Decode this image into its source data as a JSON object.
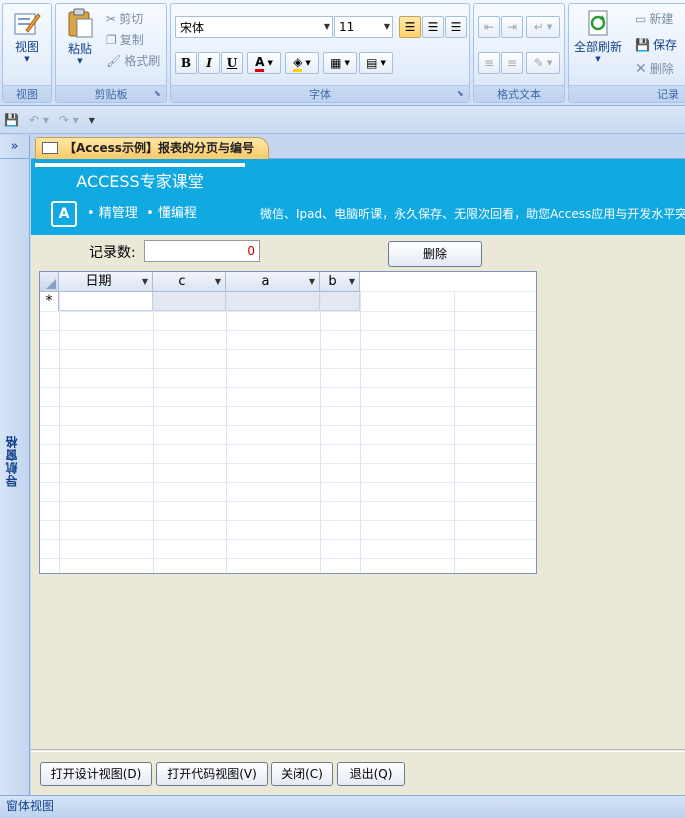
{
  "ribbon": {
    "groups": {
      "views": {
        "label": "视图",
        "button": "视图"
      },
      "clipboard": {
        "label": "剪贴板",
        "paste": "粘贴",
        "cut": "剪切",
        "copy": "复制",
        "format_painter": "格式刷"
      },
      "font": {
        "label": "字体",
        "font_name": "宋体",
        "font_size": "11",
        "bold": "B",
        "italic": "I",
        "underline": "U",
        "font_color_glyph": "A"
      },
      "rich_text": {
        "label": "格式文本"
      },
      "records": {
        "label": "记录",
        "refresh_all": "全部刷新",
        "new": "新建",
        "save": "保存",
        "delete": "删除"
      }
    }
  },
  "nav_pane": {
    "toggle": "»",
    "label": "导航窗格"
  },
  "document_tab": {
    "title": "【Access示例】报表的分页与编号"
  },
  "banner": {
    "title": "ACCESS专家课堂",
    "subtitle": "• 精管理  • 懂编程",
    "logo_letter": "A",
    "slogan": "微信、Ipad、电脑听课，永久保存、无限次回看，助您Access应用与开发水平突"
  },
  "form": {
    "record_count_label": "记录数:",
    "record_count_value": "0",
    "delete_button": "删除"
  },
  "datasheet": {
    "columns": [
      "日期",
      "c",
      "a",
      "b"
    ],
    "new_row_marker": "*"
  },
  "footer": {
    "buttons": [
      "打开设计视图(D)",
      "打开代码视图(V)",
      "关闭(C)",
      "退出(Q)"
    ]
  },
  "status_bar": {
    "text": "窗体视图"
  },
  "colors": {
    "banner": "#10a9e2",
    "tab_active": "#fcc96a",
    "form_background": "#ebe8d8"
  }
}
